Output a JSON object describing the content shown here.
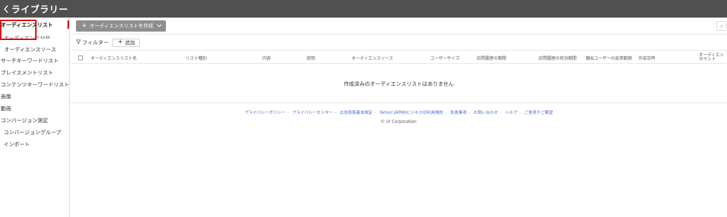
{
  "header": {
    "title": "ライブラリー",
    "back_icon": "chevron-left-icon"
  },
  "sidebar": {
    "items": [
      {
        "label": "オーディエンスリスト",
        "active": true
      },
      {
        "label": "オーディエンス分析"
      },
      {
        "label": "オーディエンスソース"
      },
      {
        "label": "サーチキーワードリスト"
      },
      {
        "label": "プレイスメントリスト"
      },
      {
        "label": "コンテンツキーワードリスト"
      },
      {
        "label": "画像"
      },
      {
        "label": "動画"
      },
      {
        "label": "コンバージョン測定"
      },
      {
        "label": "コンバージョングループ"
      },
      {
        "label": "インポート"
      }
    ]
  },
  "toolbar": {
    "create_label": "オーディエンスリストを作成",
    "right_stub": "ボ"
  },
  "filter": {
    "label": "フィルター",
    "add_label": "追加"
  },
  "table": {
    "columns": [
      "オーディエンスリスト名",
      "リスト種別",
      "内容",
      "説明",
      "オーディエンスソース",
      "ユーザーサイズ",
      "訪問履歴の期間",
      "訪問履歴の有効期間",
      "類似ユーザーの拡張範囲",
      "作成日時",
      "オーディエン",
      "カウント"
    ],
    "empty_message": "作成済みのオーディエンスリストはありません"
  },
  "footer": {
    "links": [
      "プライバシーポリシー",
      "プライバシーセンター",
      "広告取扱基本規定",
      "Yahoo! JAPANビジネスID利用規約",
      "免責事項",
      "お問い合わせ",
      "ヘルプ",
      "ご意見やご要望"
    ],
    "copyright": "© LY Corporation"
  },
  "colors": {
    "topbar": "#505050",
    "highlight": "#e00000",
    "link": "#4a6ad4",
    "button": "#8e8e8e"
  }
}
